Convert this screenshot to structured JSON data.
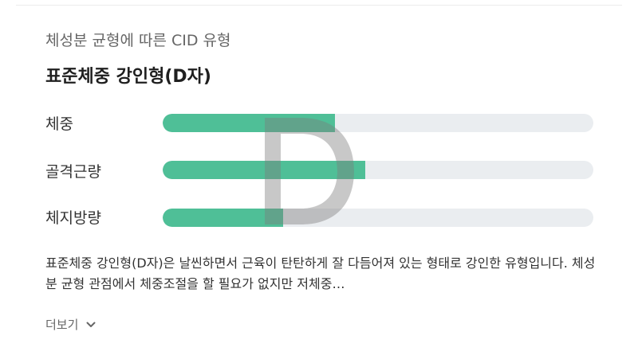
{
  "card": {
    "subtitle": "체성분 균형에 따른 CID 유형",
    "title": "표준체중 강인형(D자)",
    "rows": [
      {
        "label": "체중",
        "fill_fraction": 0.4
      },
      {
        "label": "골격근량",
        "fill_fraction": 0.47
      },
      {
        "label": "체지방량",
        "fill_fraction": 0.28
      }
    ],
    "shape_letter": "D",
    "description": "표준체중 강인형(D자)은 날씬하면서 근육이 탄탄하게 잘 다듬어져 있는 형태로 강인한 유형입니다. 체성분 균형 관점에서 체중조절을 할 필요가 없지만 저체중…",
    "more_label": "더보기",
    "more_icon": "chevron-down-icon"
  },
  "colors": {
    "bar_fill": "#4fbf97",
    "bar_track": "#eaedf0",
    "shape_overlay": "#7d7d7d"
  }
}
